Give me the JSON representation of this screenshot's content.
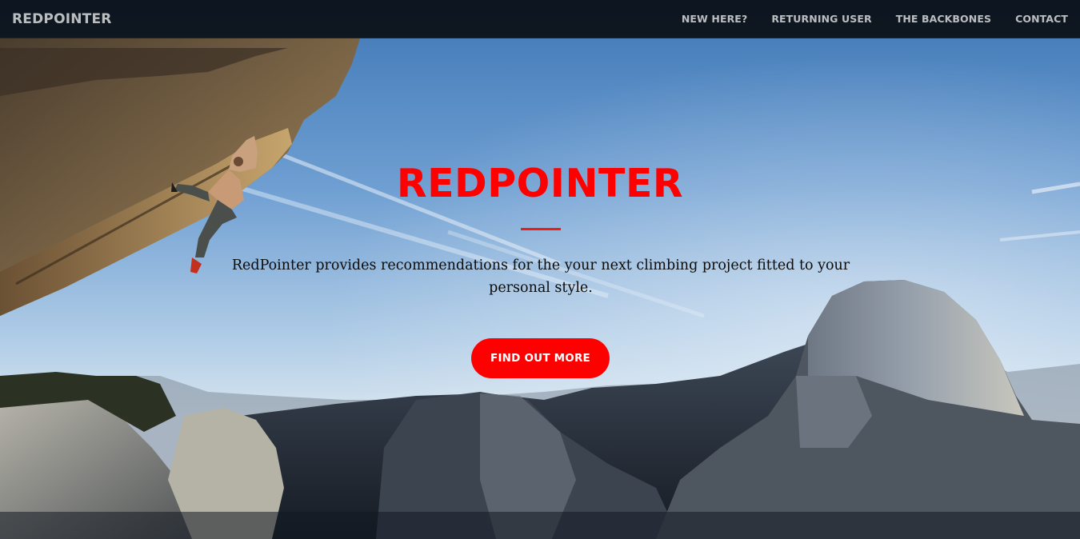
{
  "navbar": {
    "brand": "REDPOINTER",
    "items": [
      {
        "label": "NEW HERE?"
      },
      {
        "label": "RETURNING USER"
      },
      {
        "label": "THE BACKBONES"
      },
      {
        "label": "CONTACT"
      }
    ]
  },
  "hero": {
    "title": "REDPOINTER",
    "lead": "RedPointer provides recommendations for the your next climbing project fitted to your personal style.",
    "cta_label": "FIND OUT MORE",
    "background_image": "climber-on-overhang-above-mountain-valley"
  },
  "colors": {
    "accent": "#ff0000",
    "navbar_bg": "#0a0e14",
    "nav_text": "#b5b7b9",
    "lead_text": "#0b0b0b"
  }
}
